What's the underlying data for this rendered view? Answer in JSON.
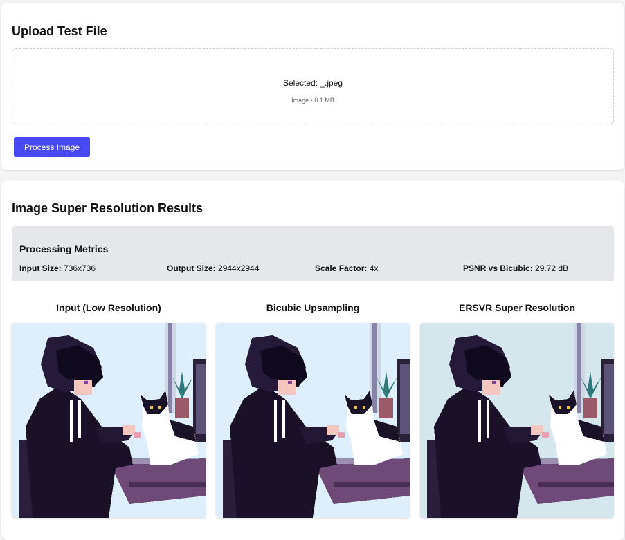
{
  "upload": {
    "title": "Upload Test File",
    "selected_label": "Selected: _.jpeg",
    "file_meta": "Image • 0.1 MB",
    "process_button": "Process Image"
  },
  "results": {
    "title": "Image Super Resolution Results",
    "metrics": {
      "title": "Processing Metrics",
      "input_size_label": "Input Size:",
      "input_size_value": "736x736",
      "output_size_label": "Output Size:",
      "output_size_value": "2944x2944",
      "scale_factor_label": "Scale Factor:",
      "scale_factor_value": "4x",
      "psnr_label": "PSNR vs Bicubic:",
      "psnr_value": "29.72 dB"
    },
    "columns": [
      {
        "title": "Input (Low Resolution)",
        "bg": "#dfeefb"
      },
      {
        "title": "Bicubic Upsampling",
        "bg": "#dfeefb"
      },
      {
        "title": "ERSVR Super Resolution",
        "bg": "#d5e6ed"
      }
    ]
  },
  "colors": {
    "accent": "#4a4af4",
    "hoodie": "#1a1028",
    "desk": "#6e4a78"
  }
}
